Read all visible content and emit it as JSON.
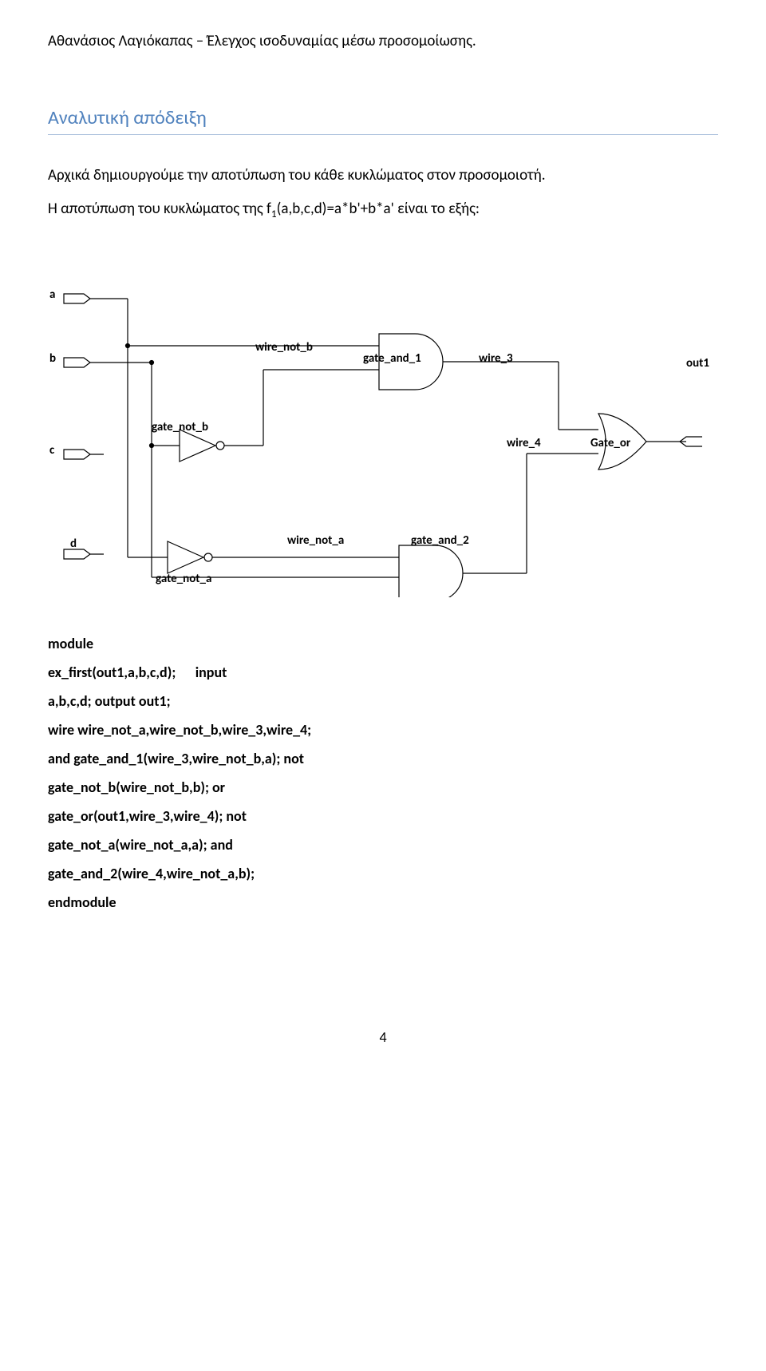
{
  "header": "Αθανάσιος Λαγιόκαπας – Έλεγχος ισοδυναμίας μέσω προσομοίωσης.",
  "section_title": "Αναλυτική απόδειξη",
  "paragraphs": {
    "p1": "Αρχικά δημιουργούμε την αποτύπωση του κάθε κυκλώματος στον προσομοιοτή.",
    "p2_prefix": "Η αποτύπωση του κυκλώματος της f",
    "p2_sub": "1",
    "p2_suffix": "(a,b,c,d)=a*b'+b*a' είναι το εξής:"
  },
  "diagram_labels": {
    "a": "a",
    "b": "b",
    "c": "c",
    "d": "d",
    "wire_not_b": "wire_not_b",
    "gate_not_b": "gate_not_b",
    "gate_and_1": "gate_and_1",
    "wire_3": "wire_3",
    "out1": "out1",
    "wire_4": "wire_4",
    "gate_or": "Gate_or",
    "gate_not_a": "gate_not_a",
    "wire_not_a": "wire_not_a",
    "gate_and_2": "gate_and_2"
  },
  "code": {
    "l1": "module",
    "l2a": "ex_first(out1,a,b,c,d);",
    "l2b": "input",
    "l3": "a,b,c,d; output out1;",
    "l4": "wire wire_not_a,wire_not_b,wire_3,wire_4;",
    "l5": "and gate_and_1(wire_3,wire_not_b,a); not",
    "l6": "gate_not_b(wire_not_b,b); or",
    "l7": "gate_or(out1,wire_3,wire_4); not",
    "l8": "gate_not_a(wire_not_a,a); and",
    "l9": "gate_and_2(wire_4,wire_not_a,b);",
    "l10": "endmodule"
  },
  "page_number": "4"
}
